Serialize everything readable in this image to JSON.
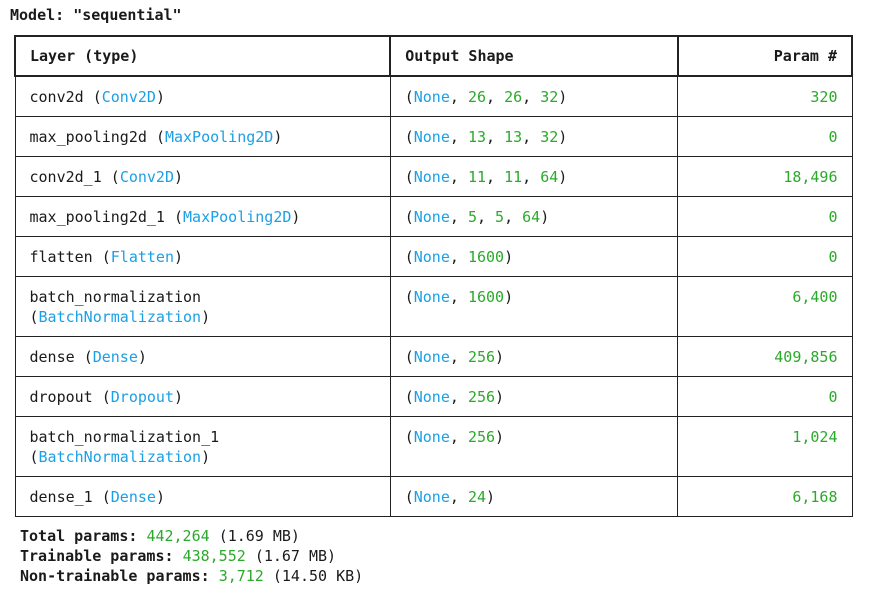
{
  "model": {
    "label": "Model:",
    "name": "\"sequential\""
  },
  "headers": {
    "layer": "Layer (type)",
    "output": "Output Shape",
    "param": "Param #"
  },
  "rows": [
    {
      "name": "conv2d",
      "type": "Conv2D",
      "dims": [
        "26",
        "26",
        "32"
      ],
      "params": "320",
      "wrap": false
    },
    {
      "name": "max_pooling2d",
      "type": "MaxPooling2D",
      "dims": [
        "13",
        "13",
        "32"
      ],
      "params": "0",
      "wrap": false
    },
    {
      "name": "conv2d_1",
      "type": "Conv2D",
      "dims": [
        "11",
        "11",
        "64"
      ],
      "params": "18,496",
      "wrap": false
    },
    {
      "name": "max_pooling2d_1",
      "type": "MaxPooling2D",
      "dims": [
        "5",
        "5",
        "64"
      ],
      "params": "0",
      "wrap": false
    },
    {
      "name": "flatten",
      "type": "Flatten",
      "dims": [
        "1600"
      ],
      "params": "0",
      "wrap": false
    },
    {
      "name": "batch_normalization",
      "type": "BatchNormalization",
      "dims": [
        "1600"
      ],
      "params": "6,400",
      "wrap": true
    },
    {
      "name": "dense",
      "type": "Dense",
      "dims": [
        "256"
      ],
      "params": "409,856",
      "wrap": false
    },
    {
      "name": "dropout",
      "type": "Dropout",
      "dims": [
        "256"
      ],
      "params": "0",
      "wrap": false
    },
    {
      "name": "batch_normalization_1",
      "type": "BatchNormalization",
      "dims": [
        "256"
      ],
      "params": "1,024",
      "wrap": true
    },
    {
      "name": "dense_1",
      "type": "Dense",
      "dims": [
        "24"
      ],
      "params": "6,168",
      "wrap": false
    }
  ],
  "none_label": "None",
  "totals": {
    "total": {
      "label": "Total params:",
      "value": "442,264",
      "size": "(1.69 MB)"
    },
    "trainable": {
      "label": "Trainable params:",
      "value": "438,552",
      "size": "(1.67 MB)"
    },
    "non_trainable": {
      "label": "Non-trainable params:",
      "value": "3,712",
      "size": "(14.50 KB)"
    }
  },
  "colors": {
    "type_cyan": "#1aa0e6",
    "number_green": "#2aaa2a"
  }
}
